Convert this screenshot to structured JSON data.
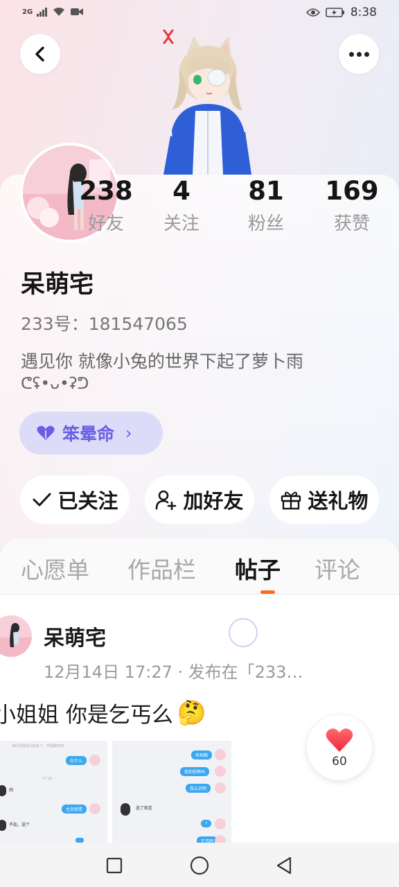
{
  "status_bar": {
    "network": "2G",
    "time": "8:38"
  },
  "profile": {
    "stats": [
      {
        "value": "238",
        "label": "好友"
      },
      {
        "value": "4",
        "label": "关注"
      },
      {
        "value": "81",
        "label": "粉丝"
      },
      {
        "value": "169",
        "label": "获赞"
      }
    ],
    "name": "呆萌宅",
    "uid": "233号：181547065",
    "bio_line1": "遇见你  就像小兔的世界下起了萝卜雨",
    "bio_line2": "ᕦʢ•ᴗ•ʡᕤ",
    "tag": "笨晕命"
  },
  "actions": {
    "follow": "已关注",
    "add_friend": "加好友",
    "gift": "送礼物"
  },
  "tabs": [
    "心愿单",
    "作品栏",
    "帖子",
    "评论"
  ],
  "active_tab": 2,
  "post": {
    "author": "呆萌宅",
    "meta": "12月14日 17:27 · 发布在「233…",
    "text": "小姐姐  你是乞丐么",
    "emoji": "🤔",
    "likes": "60",
    "screenshot1": {
      "notice": "你们已经加为好友了，开始聊天吧",
      "time": "17:16",
      "bubbles_right": [
        "在什么",
        "主页就是"
      ],
      "bubbles_left": [
        "闹",
        "不处。送个"
      ]
    },
    "screenshot2": {
      "bubbles_right": [
        "有档期",
        "我和你熟吗",
        "我认识吧",
        "?",
        "乞丐吧"
      ],
      "bubbles_left": [
        "送了就走"
      ]
    }
  },
  "colors": {
    "accent_orange": "#ff6a1a",
    "tag_purple": "#6a5fe0",
    "like_red": "#ff3b4e"
  }
}
